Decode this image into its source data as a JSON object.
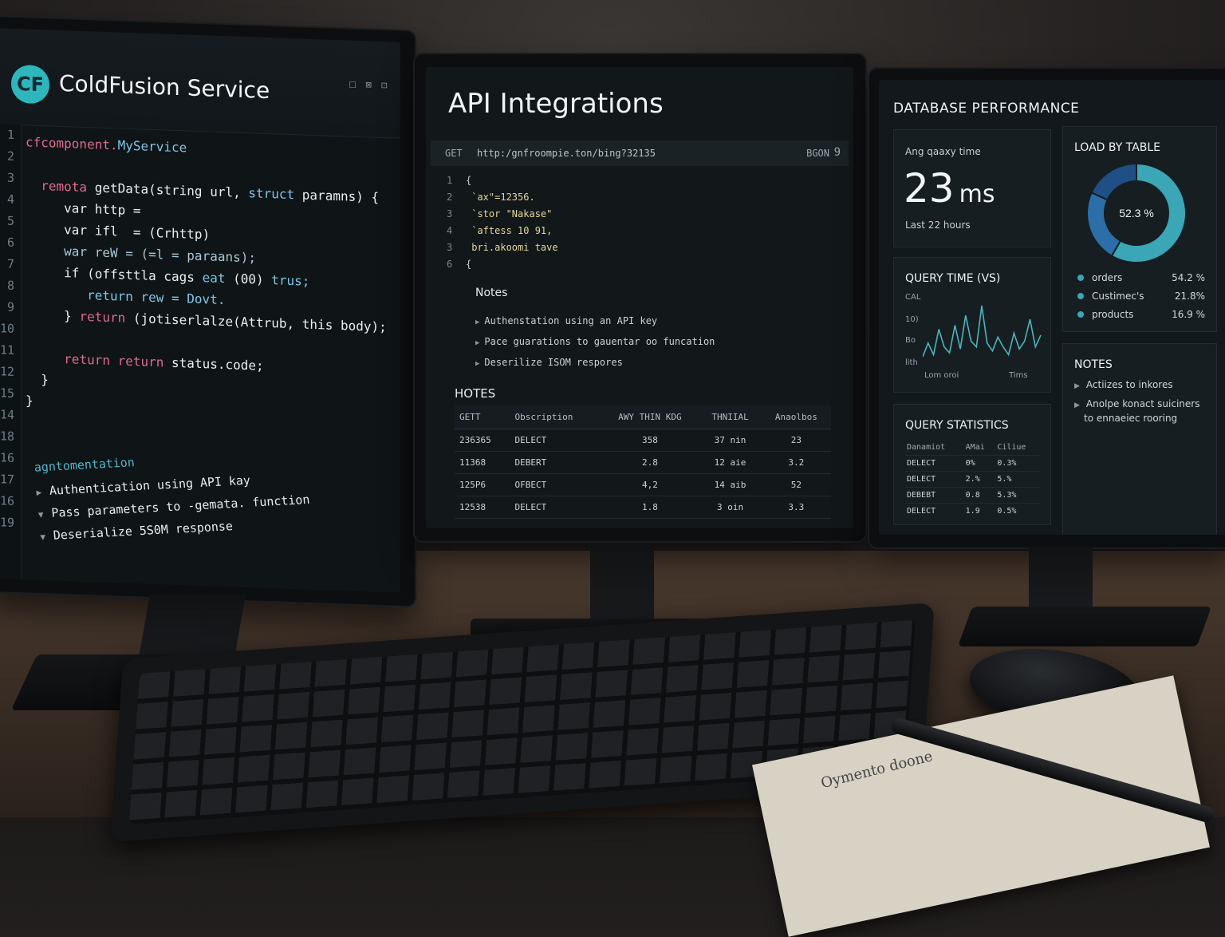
{
  "left_screen": {
    "logo_text": "CF",
    "title": "ColdFusion Service",
    "window_icons": "□ ⊠ ⊡",
    "line_numbers": [
      "1",
      "2",
      "3",
      "4",
      "5",
      "6",
      "7",
      "8",
      "9",
      "10",
      "11",
      "12",
      "15",
      "14",
      "18",
      "16",
      "17",
      "16",
      "19"
    ],
    "code": {
      "l1_kw": "cfcomponent.",
      "l1_name": "MyService",
      "l3_kw": "remota",
      "l3_fn": " getData(string url, ",
      "l3_ty": "struct",
      "l3_rest": " paramns) {",
      "l4": "var http =",
      "l5": "var ifl  = (Crhttp)",
      "l6": "war reW = (=l = paraans);",
      "l7_a": "if (offsttla cags ",
      "l7_b": "eat",
      "l7_c": " (00) ",
      "l7_d": "trus;",
      "l8_kw": "return",
      "l8_rest": " rew = Dovt.",
      "l9_a": "} ",
      "l9_kw": "return",
      "l9_b": " (jotiserlalze(Attrub, this body);",
      "l11_kw": "return return",
      "l11_rest": " status.code;",
      "l12": "}",
      "l15": "}"
    },
    "doc_title": "agntomentation",
    "doc_items": [
      "Authentication using API kay",
      "Pass parameters to -gemata. function",
      "Deserialize 5S0M response"
    ]
  },
  "center_screen": {
    "title": "API Integrations",
    "method": "GET",
    "url": "http:/gnfroompie.ton/bing?32135",
    "right_label": "BGON",
    "right_icon": "9",
    "json_lines": [
      {
        "n": "1",
        "t": "{"
      },
      {
        "n": "2",
        "t": " `ax\"=12356."
      },
      {
        "n": "3",
        "t": " `stor \"Nakase\""
      },
      {
        "n": "4",
        "t": " `aftess 10 91,"
      },
      {
        "n": "3",
        "t": " bri.akoomi tave"
      },
      {
        "n": "6",
        "t": "{"
      }
    ],
    "notes_title": "Notes",
    "notes": [
      "Authenstation using an API key",
      "Pace guarations to  gauentar oo funcation",
      "Deserilize ISOM respores"
    ],
    "table_title": "HOTES",
    "table_headers": [
      "GETT",
      "Obscription",
      "AWY THIN KDG",
      "THNIIAL",
      "Anaolbos"
    ],
    "table_rows": [
      [
        "236365",
        "DELECT",
        "358",
        "37 nin",
        "23"
      ],
      [
        "11368",
        "DEBERT",
        "2.8",
        "12 aie",
        "3.2"
      ],
      [
        "125P6",
        "OFBECT",
        "4,2",
        "14 aib",
        "52"
      ],
      [
        "12538",
        "DELECT",
        "1.8",
        "3 oin",
        "3.3"
      ]
    ]
  },
  "right_screen": {
    "title": "DATABASE PERFORMANCE",
    "avg_label": "Ang qaaxy time",
    "avg_value": "23",
    "avg_unit": "ms",
    "avg_sub": "Last 22 hours",
    "load_title": "LOAD BY TABLE",
    "donut_center": "52.3 %",
    "load_items": [
      {
        "name": "orders",
        "pct": "54.2 %",
        "value": 54.2
      },
      {
        "name": "Custimec's",
        "pct": "21.8%",
        "value": 21.8
      },
      {
        "name": "products",
        "pct": "16.9 %",
        "value": 16.9
      }
    ],
    "query_time_title": "QUERY TIME (VS)",
    "qt_ylabels": [
      "CAL",
      "10)",
      "Bo",
      "lith"
    ],
    "qt_xlabels": [
      "Lom oroi",
      "Tims"
    ],
    "qt_values": [
      20,
      34,
      22,
      48,
      30,
      24,
      52,
      28,
      62,
      36,
      30,
      72,
      34,
      26,
      40,
      30,
      22,
      44,
      28,
      36,
      58,
      30,
      42
    ],
    "notes_title": "NOTES",
    "notes": [
      "Actiizes to inkores",
      "Anolpe konact suiciners",
      "to ennaeiec rooring"
    ],
    "qs_title": "QUERY STATISTICS",
    "qs_headers": [
      "Danamiot",
      "AMai",
      "Ciliue"
    ],
    "qs_rows": [
      [
        "DELECT",
        "0%",
        "0.3%"
      ],
      [
        "DELECT",
        "2.%",
        "5.%"
      ],
      [
        "DEBEBT",
        "0.8",
        "5.3%"
      ],
      [
        "DELECT",
        "1.9",
        "0.5%"
      ]
    ]
  },
  "desk": {
    "notepad_text": "Oymento doone"
  },
  "colors": {
    "accent": "#2fb6bd",
    "keyword": "#e06c8c",
    "type": "#7fc7e8",
    "donut_1": "#3aa6b6",
    "donut_2": "#2b6ea8",
    "donut_3": "#1f4f84"
  }
}
